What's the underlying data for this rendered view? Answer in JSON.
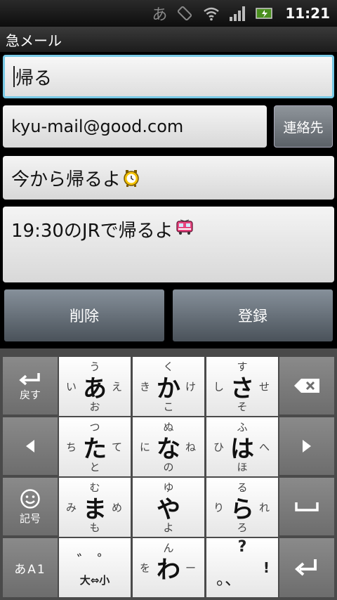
{
  "statusbar": {
    "ime": "あ",
    "clock": "11:21"
  },
  "title": "急メール",
  "subject": {
    "value": "帰る"
  },
  "address": {
    "value": "kyu-mail@good.com"
  },
  "contacts_label": "連絡先",
  "heading": {
    "value": "今から帰るよ"
  },
  "body": {
    "value": "19:30のJRで帰るよ"
  },
  "buttons": {
    "delete": "削除",
    "register": "登録"
  },
  "keyboard": {
    "back": "戻す",
    "symbols": "記号",
    "mode": "あA1",
    "rows": [
      [
        {
          "main": "あ",
          "up": "う",
          "dn": "お",
          "lf": "い",
          "rt": "え"
        },
        {
          "main": "か",
          "up": "く",
          "dn": "こ",
          "lf": "き",
          "rt": "け"
        },
        {
          "main": "さ",
          "up": "す",
          "dn": "そ",
          "lf": "し",
          "rt": "せ"
        }
      ],
      [
        {
          "main": "た",
          "up": "つ",
          "dn": "と",
          "lf": "ち",
          "rt": "て"
        },
        {
          "main": "な",
          "up": "ぬ",
          "dn": "の",
          "lf": "に",
          "rt": "ね"
        },
        {
          "main": "は",
          "up": "ふ",
          "dn": "ほ",
          "lf": "ひ",
          "rt": "へ"
        }
      ],
      [
        {
          "main": "ま",
          "up": "む",
          "dn": "も",
          "lf": "み",
          "rt": "め"
        },
        {
          "main": "や",
          "up": "ゆ",
          "dn": "よ",
          "lf": "",
          "rt": ""
        },
        {
          "main": "ら",
          "up": "る",
          "dn": "ろ",
          "lf": "り",
          "rt": "れ"
        }
      ],
      [
        {
          "main": "",
          "up": "",
          "dn": "",
          "lf": "",
          "rt": ""
        },
        {
          "main": "わ",
          "up": "ん",
          "dn": "",
          "lf": "を",
          "rt": "ー"
        },
        {
          "main": "",
          "up": "?",
          "dn": "",
          "lf": "",
          "rt": "!"
        }
      ]
    ],
    "dakuten_top": "゛ ゜",
    "size_toggle": "大⇔小",
    "punct": "。、"
  }
}
